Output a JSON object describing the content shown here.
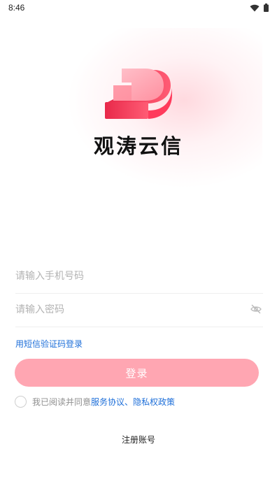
{
  "status_bar": {
    "time": "8:46",
    "icons": [
      "wifi-icon",
      "battery-icon"
    ]
  },
  "app": {
    "name": "观涛云信",
    "logo": "app-logo",
    "accent_color": "#ff4d6a",
    "button_color": "#ffa6b2",
    "link_color": "#1e6fd9"
  },
  "form": {
    "phone_placeholder": "请输入手机号码",
    "phone_value": "",
    "password_placeholder": "请输入密码",
    "password_value": "",
    "password_toggle_icon": "eye-slash-icon",
    "sms_login_label": "用短信验证码登录",
    "login_label": "登录"
  },
  "agreement": {
    "checked": false,
    "prefix": "我已阅读并同意",
    "service_link": "服务协议",
    "separator": "、",
    "privacy_link": "隐私权政策"
  },
  "register_label": "注册账号"
}
